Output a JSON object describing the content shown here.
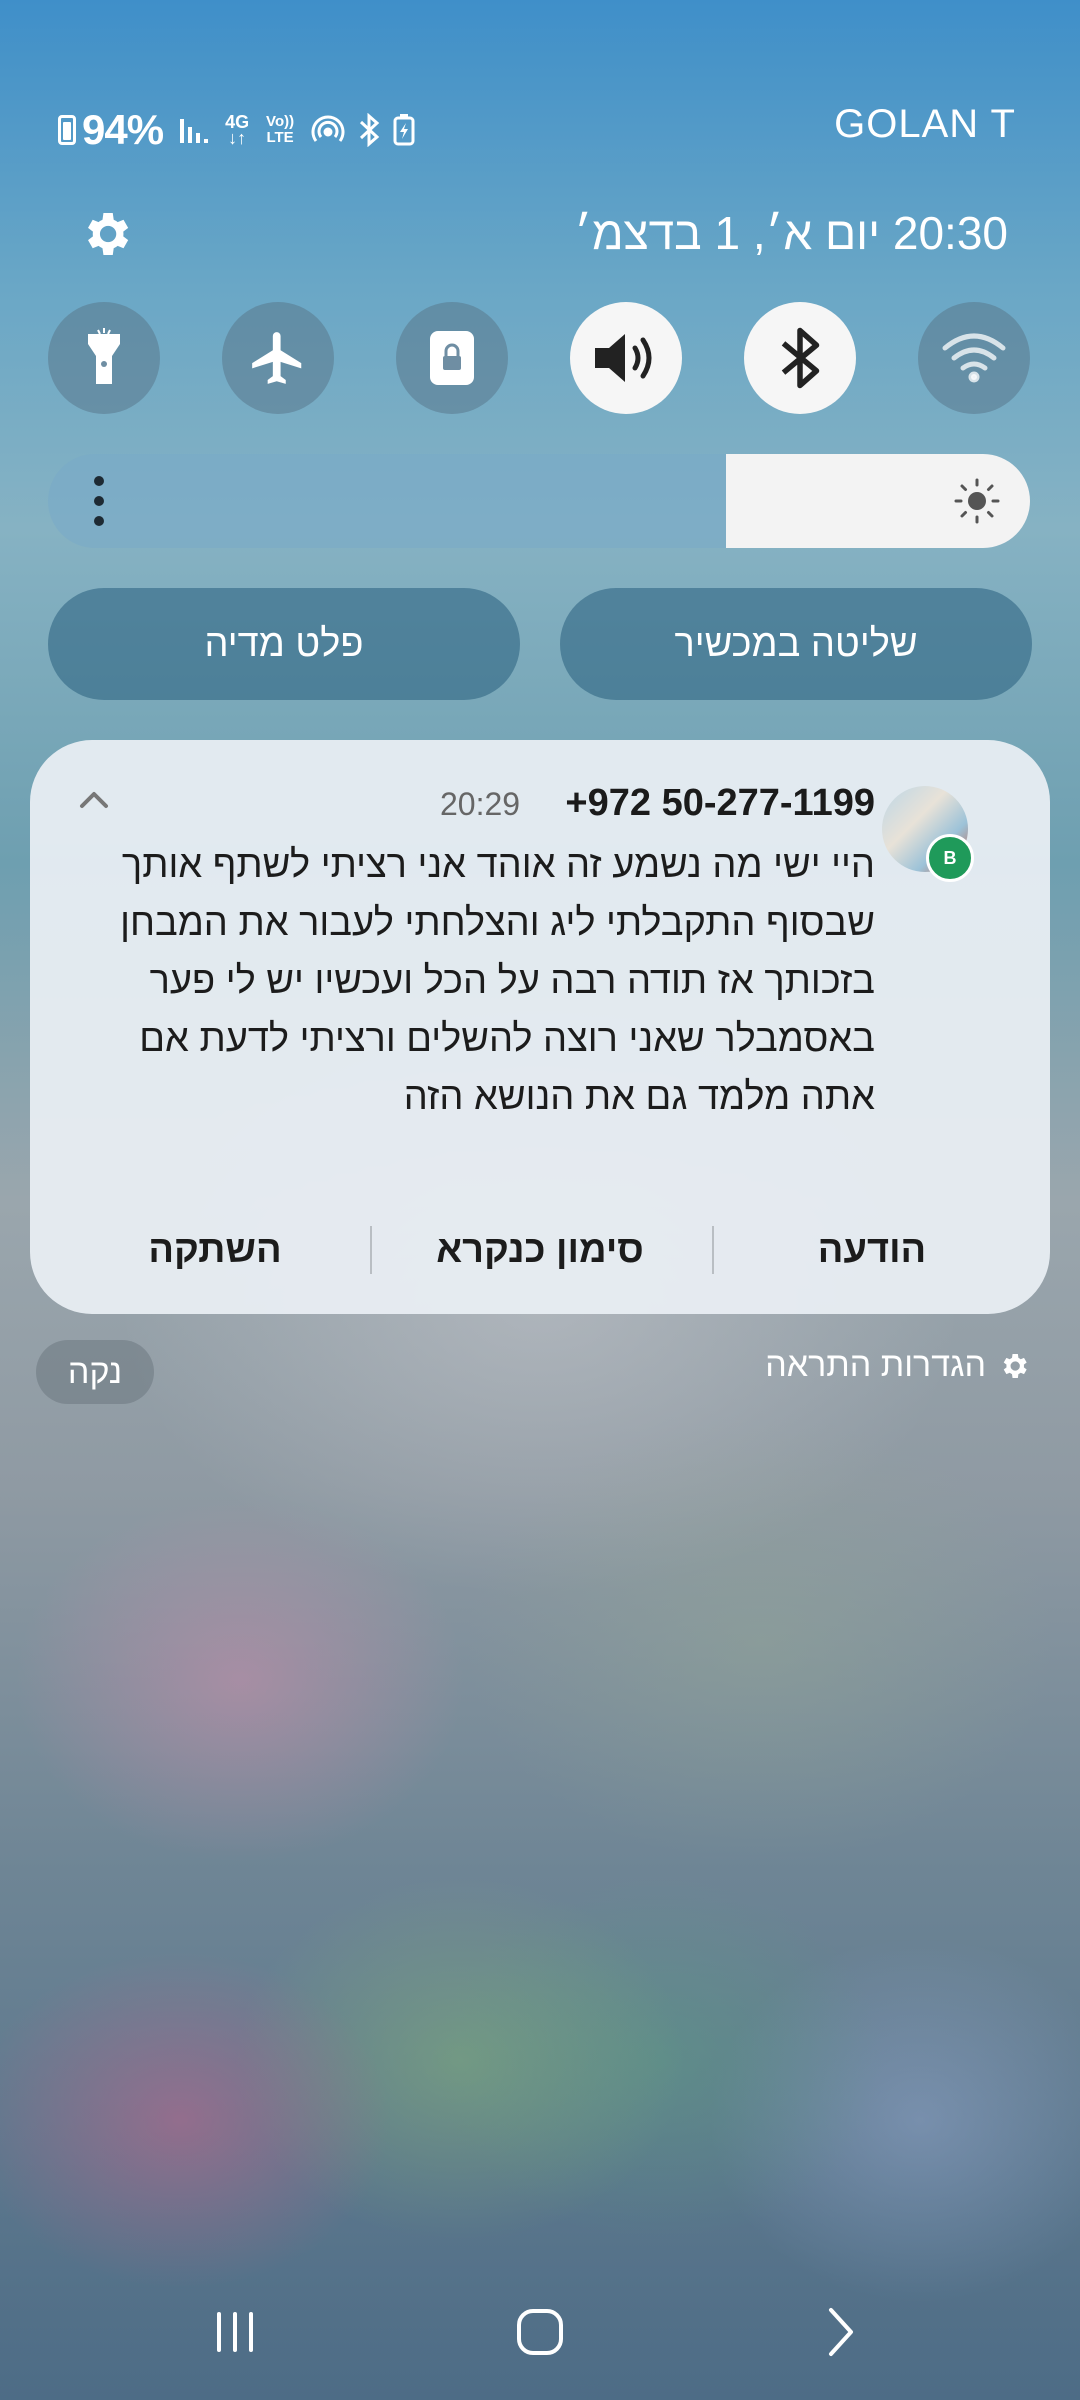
{
  "status_bar": {
    "battery_percent": "94%",
    "carrier": "GOLAN T",
    "icons": [
      "battery-icon",
      "signal-bars-icon",
      "4g-data-icon",
      "volte-icon",
      "hotspot-icon",
      "bluetooth-icon",
      "battery-saver-icon"
    ],
    "signal_label": "4G",
    "volte_label": "Vo)) LTE"
  },
  "header": {
    "datetime": "20:30 יום א׳, 1 בדצמ׳",
    "settings_icon": "gear-icon"
  },
  "quick_toggles": [
    {
      "icon": "flashlight-icon",
      "active": false
    },
    {
      "icon": "airplane-icon",
      "active": false
    },
    {
      "icon": "rotation-lock-icon",
      "active": false
    },
    {
      "icon": "sound-icon",
      "active": true
    },
    {
      "icon": "bluetooth-icon",
      "active": true
    },
    {
      "icon": "wifi-icon",
      "active": false
    }
  ],
  "brightness": {
    "level_fraction": 0.31,
    "icon": "sun-icon"
  },
  "panels": {
    "media_output": "פלט מדיה",
    "device_control": "שליטה במכשיר"
  },
  "notification": {
    "sender": "+972 50-277-1199",
    "time": "20:29",
    "badge_letter": "B",
    "message": "היי ישי מה נשמע זה אוהד אני רציתי לשתף אותך שבסוף התקבלתי ליג והצלחתי לעבור את המבחן בזכותך אז תודה רבה על הכל ועכשיו יש לי פער באסמבלר שאני רוצה להשלים ורציתי לדעת אם אתה מלמד גם את הנושא הזה",
    "actions": {
      "reply": "הודעה",
      "mark_read": "סימון כנקרא",
      "mute": "השתקה"
    }
  },
  "footer": {
    "clear": "נקה",
    "notification_settings": "הגדרות התראה"
  },
  "colors": {
    "badge_green": "#1f9a5a",
    "card_bg": "#e9eef3",
    "toggle_on": "#f6f6f6"
  }
}
